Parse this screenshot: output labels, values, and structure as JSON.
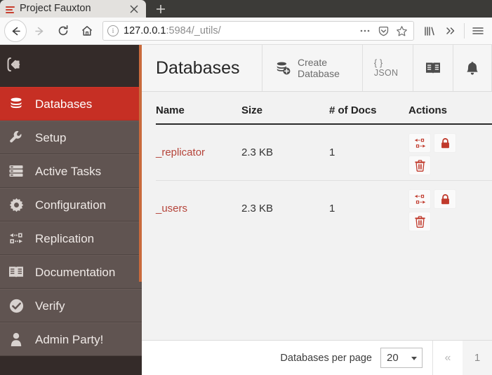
{
  "browser": {
    "tab": {
      "title": "Project Fauxton",
      "favicon_icon": "fauxton-favicon",
      "close_icon": "close-icon"
    },
    "new_tab_icon": "plus-icon",
    "nav": {
      "back_icon": "back-arrow-icon",
      "forward_icon": "forward-arrow-icon",
      "reload_icon": "reload-icon",
      "home_icon": "home-icon"
    },
    "url": {
      "info_icon": "info-icon",
      "host": "127.0.0.1",
      "path": ":5984/_utils/",
      "page_actions_icon": "ellipsis-icon",
      "pocket_icon": "pocket-icon",
      "bookmark_icon": "star-icon"
    },
    "toolbar": {
      "library_icon": "library-icon",
      "overflow_icon": "double-chevron-icon",
      "menu_icon": "hamburger-menu-icon"
    }
  },
  "sidebar": {
    "collapse_icon": "collapse-sidebar-icon",
    "items": [
      {
        "label": "Databases",
        "icon": "database-icon",
        "active": true
      },
      {
        "label": "Setup",
        "icon": "wrench-icon",
        "active": false
      },
      {
        "label": "Active Tasks",
        "icon": "tasks-icon",
        "active": false
      },
      {
        "label": "Configuration",
        "icon": "gear-icon",
        "active": false
      },
      {
        "label": "Replication",
        "icon": "replication-icon",
        "active": false
      },
      {
        "label": "Documentation",
        "icon": "book-icon",
        "active": false
      },
      {
        "label": "Verify",
        "icon": "check-circle-icon",
        "active": false
      },
      {
        "label": "Admin Party!",
        "icon": "user-icon",
        "active": false
      }
    ]
  },
  "header": {
    "title": "Databases",
    "create_database_label": "Create Database",
    "create_database_icon": "database-plus-icon",
    "json_label": "{ } JSON",
    "docs_icon": "book-icon",
    "notifications_icon": "bell-icon"
  },
  "table": {
    "columns": [
      "Name",
      "Size",
      "# of Docs",
      "Actions"
    ],
    "rows": [
      {
        "name": "_replicator",
        "size": "2.3 KB",
        "docs": "1",
        "actions": [
          "replicate-icon",
          "lock-icon",
          "delete-icon"
        ]
      },
      {
        "name": "_users",
        "size": "2.3 KB",
        "docs": "1",
        "actions": [
          "replicate-icon",
          "lock-icon",
          "delete-icon"
        ]
      }
    ]
  },
  "footer": {
    "per_page_label": "Databases per page",
    "per_page_value": "20",
    "prev_label": "«",
    "page_label": "1"
  },
  "colors": {
    "accent_red": "#c62f24",
    "sidebar_bg": "#342b29",
    "sidebar_item_bg": "#605451",
    "scrollbar_orange": "#c96a3c",
    "link_red": "#b5443a"
  }
}
